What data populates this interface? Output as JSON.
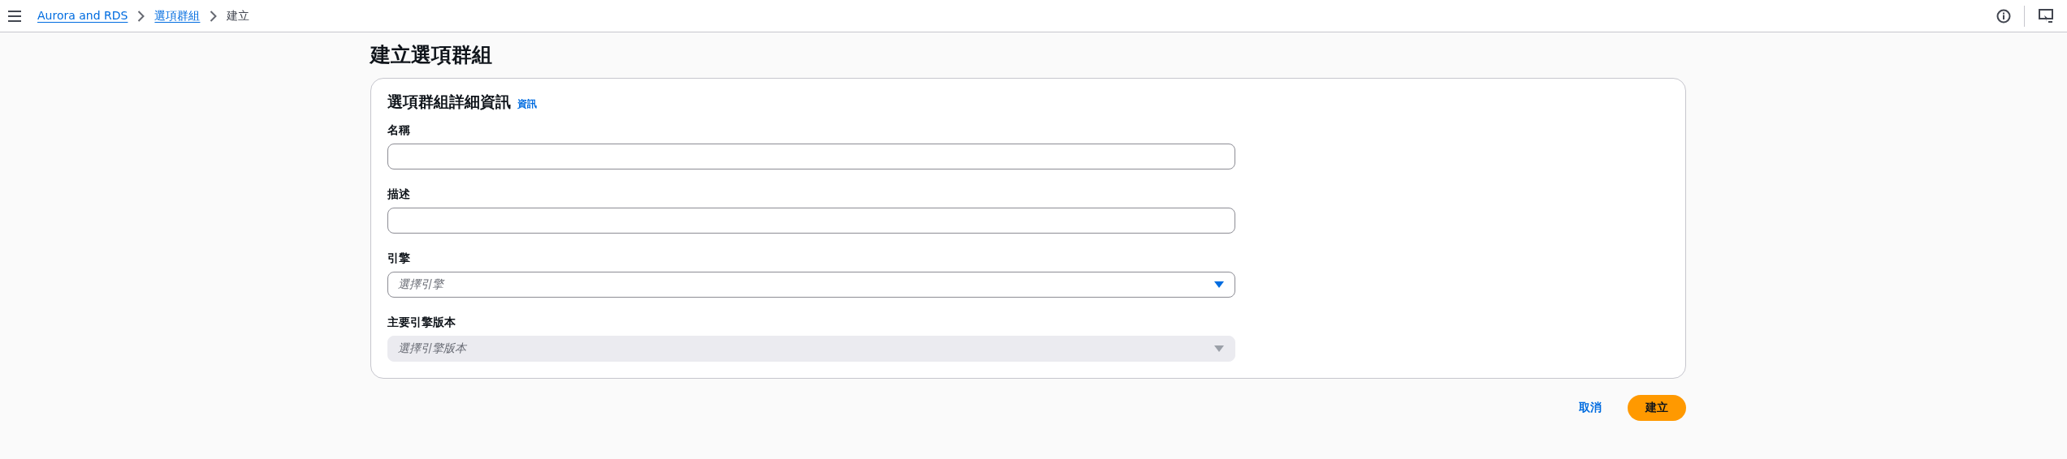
{
  "breadcrumbs": [
    {
      "label": "Aurora and RDS",
      "link": true
    },
    {
      "label": "選項群組",
      "link": true
    },
    {
      "label": "建立",
      "link": false
    }
  ],
  "page_title": "建立選項群組",
  "card": {
    "title": "選項群組詳細資訊",
    "info_link": "資訊",
    "fields": [
      {
        "kind": "text",
        "label": "名稱",
        "disabled": false
      },
      {
        "kind": "text",
        "label": "描述",
        "disabled": false
      },
      {
        "kind": "select",
        "label": "引擎",
        "placeholder": "選擇引擎",
        "disabled": false
      },
      {
        "kind": "select",
        "label": "主要引擎版本",
        "placeholder": "選擇引擎版本",
        "disabled": true
      }
    ]
  },
  "actions": {
    "cancel": "取消",
    "submit": "建立"
  }
}
